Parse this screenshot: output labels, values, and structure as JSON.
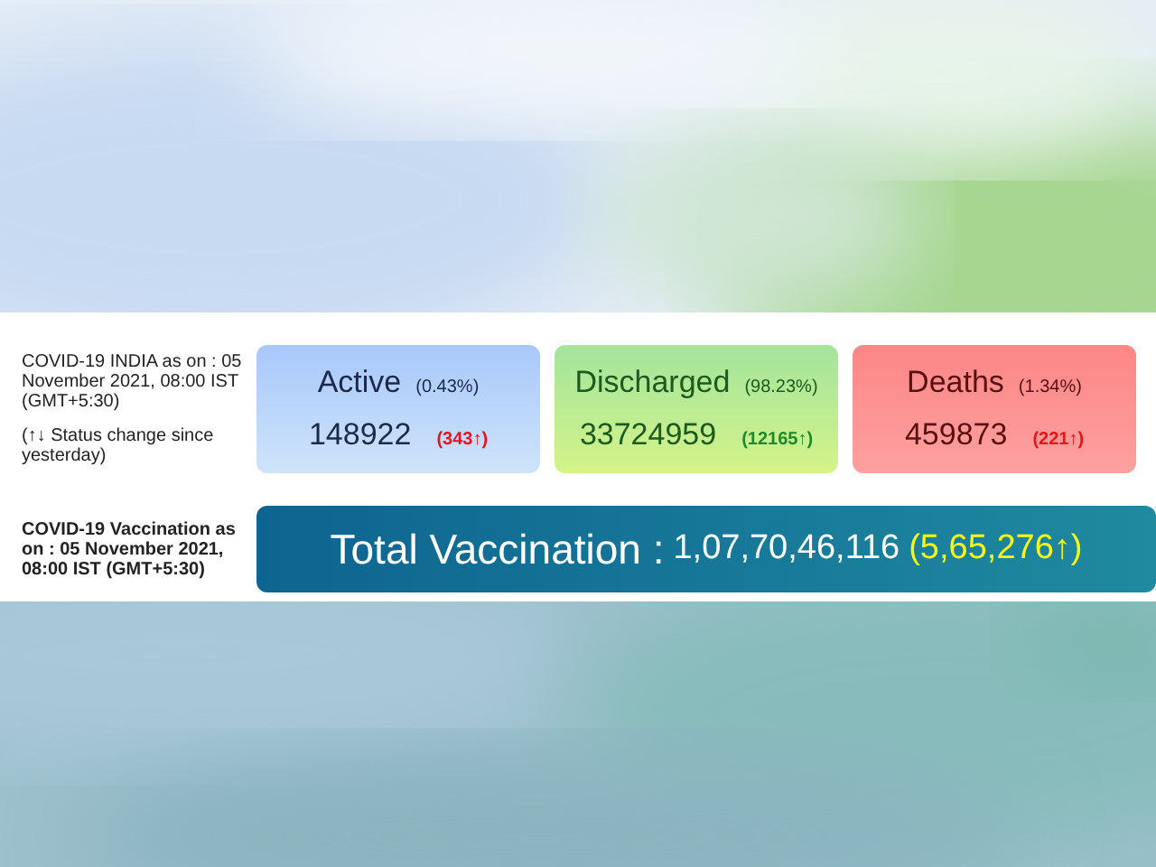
{
  "info": {
    "as_on": "COVID-19 INDIA as on : 05 November 2021, 08:00 IST (GMT+5:30)",
    "legend": "(↑↓ Status change since yesterday)"
  },
  "cards": [
    {
      "kind": "active",
      "label": "Active",
      "percent": "(0.43%)",
      "count": "148922",
      "change": "(343↑)"
    },
    {
      "kind": "discharged",
      "label": "Discharged",
      "percent": "(98.23%)",
      "count": "33724959",
      "change": "(12165↑)"
    },
    {
      "kind": "deaths",
      "label": "Deaths",
      "percent": "(1.34%)",
      "count": "459873",
      "change": "(221↑)"
    }
  ],
  "vaccination": {
    "as_on": "COVID-19 Vaccination as on : 05 November 2021, 08:00 IST (GMT+5:30)",
    "label": "Total Vaccination :",
    "total": "1,07,70,46,116",
    "change": "(5,65,276↑)"
  }
}
